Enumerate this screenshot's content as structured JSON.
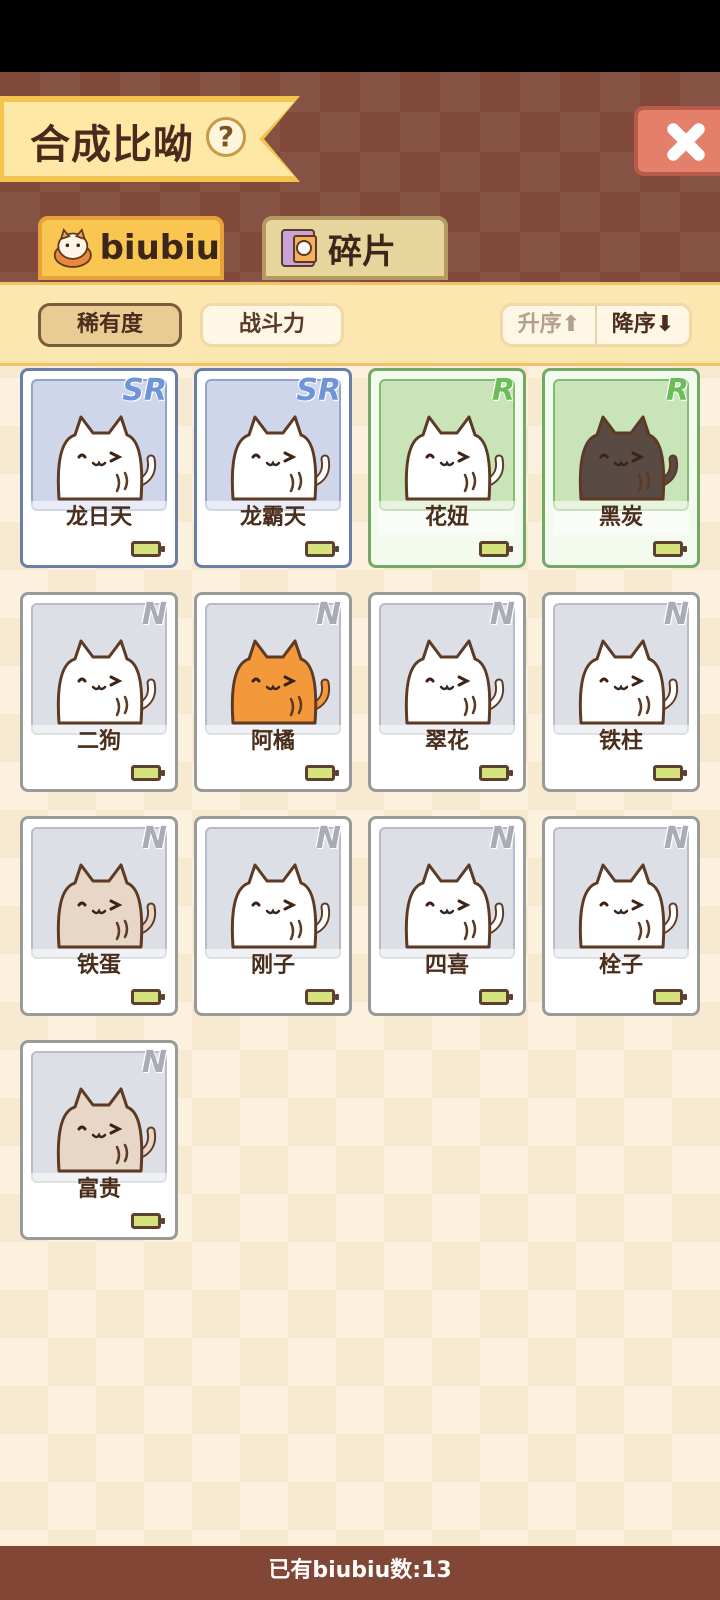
{
  "header": {
    "title": "合成比呦",
    "help_label": "?"
  },
  "tabs": [
    {
      "label": "biubiu",
      "active": true
    },
    {
      "label": "碎片",
      "active": false
    }
  ],
  "sort": {
    "rarity_label": "稀有度",
    "power_label": "战斗力",
    "asc_label": "升序",
    "desc_label": "降序",
    "asc_arrow": "⬆",
    "desc_arrow": "⬇"
  },
  "cards": [
    {
      "name": "龙日天",
      "rarity": "SR",
      "cat_color": "#ffffff"
    },
    {
      "name": "龙霸天",
      "rarity": "SR",
      "cat_color": "#ffffff"
    },
    {
      "name": "花妞",
      "rarity": "R",
      "cat_color": "#ffffff"
    },
    {
      "name": "黑炭",
      "rarity": "R",
      "cat_color": "#5a4a44"
    },
    {
      "name": "二狗",
      "rarity": "N",
      "cat_color": "#ffffff"
    },
    {
      "name": "阿橘",
      "rarity": "N",
      "cat_color": "#f3983b"
    },
    {
      "name": "翠花",
      "rarity": "N",
      "cat_color": "#ffffff"
    },
    {
      "name": "铁柱",
      "rarity": "N",
      "cat_color": "#ffffff"
    },
    {
      "name": "铁蛋",
      "rarity": "N",
      "cat_color": "#e8d6c6"
    },
    {
      "name": "刚子",
      "rarity": "N",
      "cat_color": "#ffffff"
    },
    {
      "name": "四喜",
      "rarity": "N",
      "cat_color": "#ffffff"
    },
    {
      "name": "栓子",
      "rarity": "N",
      "cat_color": "#ffffff"
    },
    {
      "name": "富贵",
      "rarity": "N",
      "cat_color": "#e8d6c6"
    }
  ],
  "footer": {
    "count_text": "已有biubiu数:13"
  },
  "colors": {
    "header_bg": "#80493a",
    "ribbon": "#f3c44f",
    "close_button": "#e4806a",
    "tab_active": "#f9c652",
    "background": "#fbf1dc"
  },
  "icons": [
    "help-icon",
    "close-icon",
    "cat-avatar-icon",
    "fragment-icon",
    "arrow-up-icon",
    "arrow-down-icon",
    "battery-icon"
  ]
}
